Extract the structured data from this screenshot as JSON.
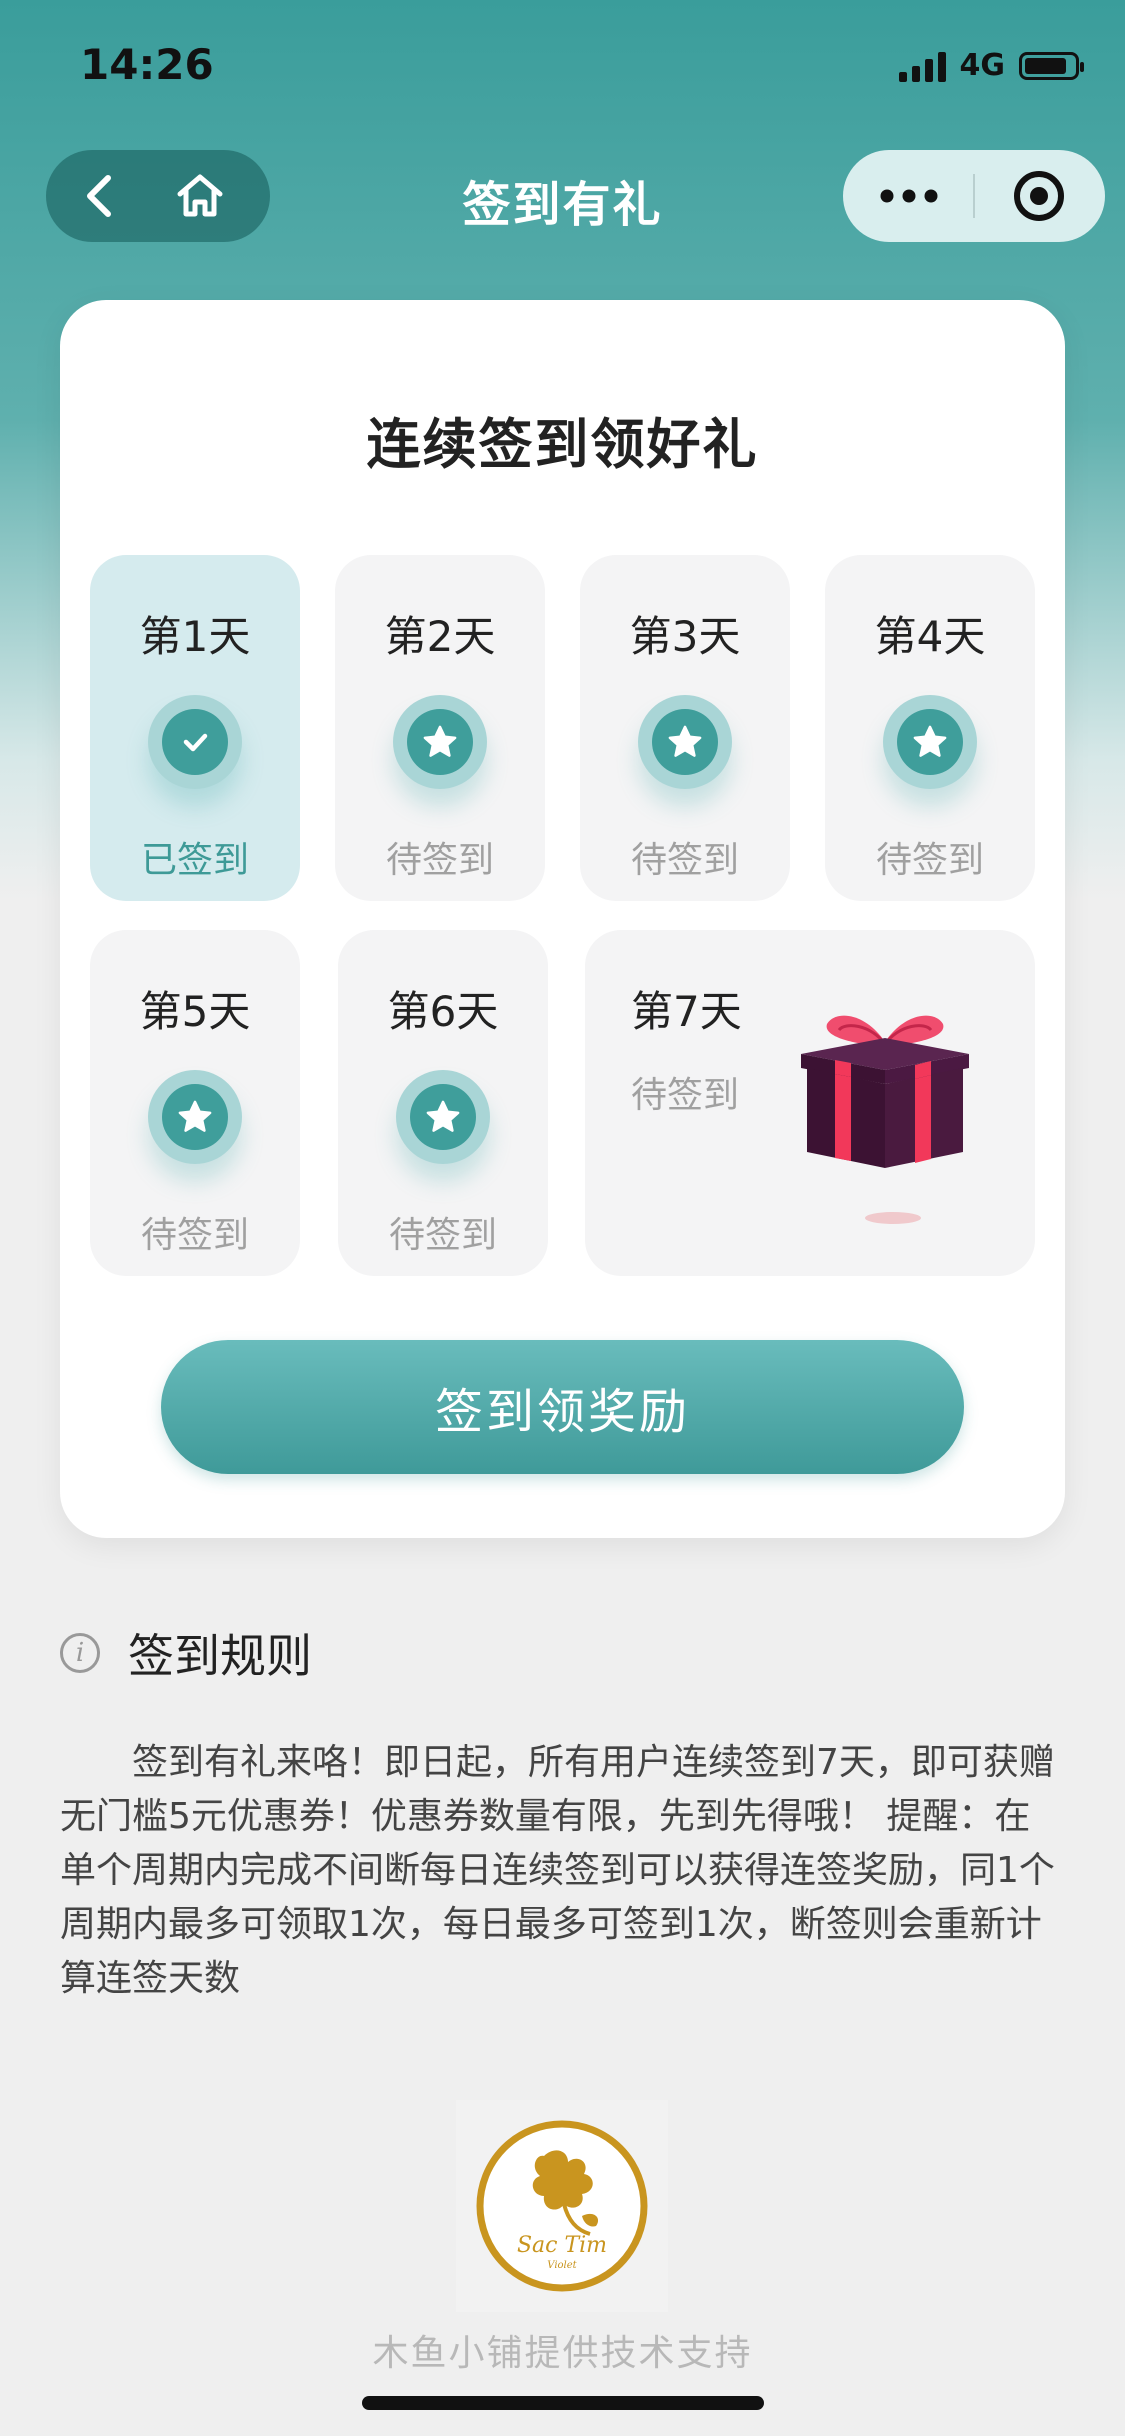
{
  "status_bar": {
    "time": "14:26",
    "network": "4G",
    "battery_level": 0.85
  },
  "nav": {
    "title": "签到有礼"
  },
  "card": {
    "title": "连续签到领好礼",
    "days": [
      {
        "label": "第1天",
        "status": "已签到",
        "signed": true
      },
      {
        "label": "第2天",
        "status": "待签到",
        "signed": false
      },
      {
        "label": "第3天",
        "status": "待签到",
        "signed": false
      },
      {
        "label": "第4天",
        "status": "待签到",
        "signed": false
      },
      {
        "label": "第5天",
        "status": "待签到",
        "signed": false
      },
      {
        "label": "第6天",
        "status": "待签到",
        "signed": false
      },
      {
        "label": "第7天",
        "status": "待签到",
        "signed": false
      }
    ],
    "cta_label": "签到领奖励"
  },
  "rules": {
    "title": "签到规则",
    "text": "签到有礼来咯！即日起，所有用户连续签到7天，即可获赠无门槛5元优惠券！优惠券数量有限，先到先得哦！        提醒：在单个周期内完成不间断每日连续签到可以获得连签奖励，同1个周期内最多可领取1次，每日最多可签到1次，断签则会重新计算连签天数"
  },
  "footer": {
    "logo_text": "Sac Tim",
    "logo_subtext": "Violet",
    "text": "木鱼小铺提供技术支持"
  },
  "colors": {
    "accent": "#3f9e9b",
    "done_bg": "#d5ebee",
    "gift_box": "#4a1a3f",
    "gift_ribbon": "#f2385a"
  }
}
